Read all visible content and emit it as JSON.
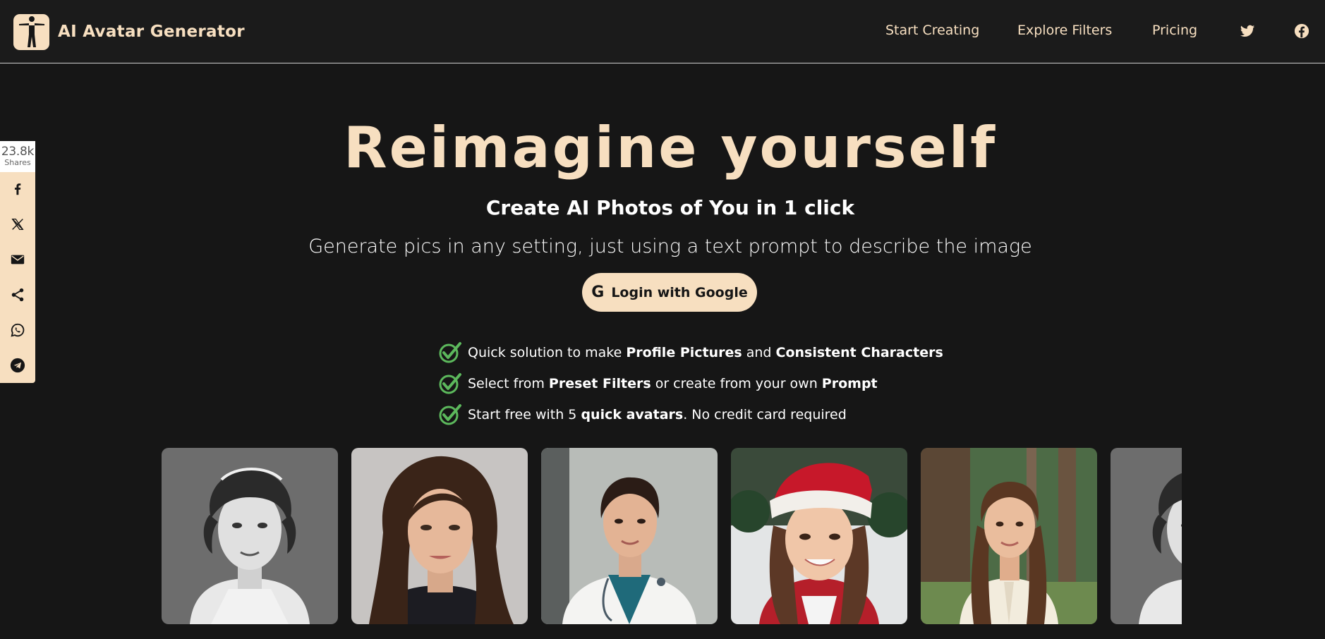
{
  "header": {
    "brand_name": "AI Avatar Generator",
    "brand_logo_icon": "human-silhouette-icon",
    "nav": [
      {
        "label": "Start Creating"
      },
      {
        "label": "Explore Filters"
      },
      {
        "label": "Pricing"
      }
    ],
    "social_icons": [
      "twitter-icon",
      "facebook-icon"
    ]
  },
  "share_bar": {
    "count": "23.8k",
    "count_label": "Shares",
    "buttons": [
      "facebook-icon",
      "x-icon",
      "email-icon",
      "share-icon",
      "whatsapp-icon",
      "telegram-icon"
    ]
  },
  "hero": {
    "title": "Reimagine yourself",
    "subtitle": "Create AI Photos of You in 1 click",
    "description": "Generate pics in any setting, just using a text prompt to describe the image",
    "login_button": "Login with Google",
    "login_icon": "G"
  },
  "features": [
    {
      "parts": [
        {
          "text": "Quick solution to make ",
          "bold": false
        },
        {
          "text": "Profile Pictures",
          "bold": true
        },
        {
          "text": " and ",
          "bold": false
        },
        {
          "text": "Consistent Characters",
          "bold": true
        }
      ]
    },
    {
      "parts": [
        {
          "text": "Select from ",
          "bold": false
        },
        {
          "text": "Preset Filters",
          "bold": true
        },
        {
          "text": " or create from your own ",
          "bold": false
        },
        {
          "text": "Prompt",
          "bold": true
        }
      ]
    },
    {
      "parts": [
        {
          "text": "Start free with 5 ",
          "bold": false
        },
        {
          "text": "quick avatars",
          "bold": true
        },
        {
          "text": ". No credit card required",
          "bold": false
        }
      ]
    }
  ],
  "colors": {
    "accent": "#f7dfc0",
    "background": "#161616",
    "check": "#5cb85c"
  },
  "gallery": [
    {
      "name": "vintage-bw-portrait"
    },
    {
      "name": "professional-portrait"
    },
    {
      "name": "doctor-portrait"
    },
    {
      "name": "santa-hat-portrait"
    },
    {
      "name": "forest-portrait"
    },
    {
      "name": "vintage-bw-portrait-repeat"
    }
  ]
}
